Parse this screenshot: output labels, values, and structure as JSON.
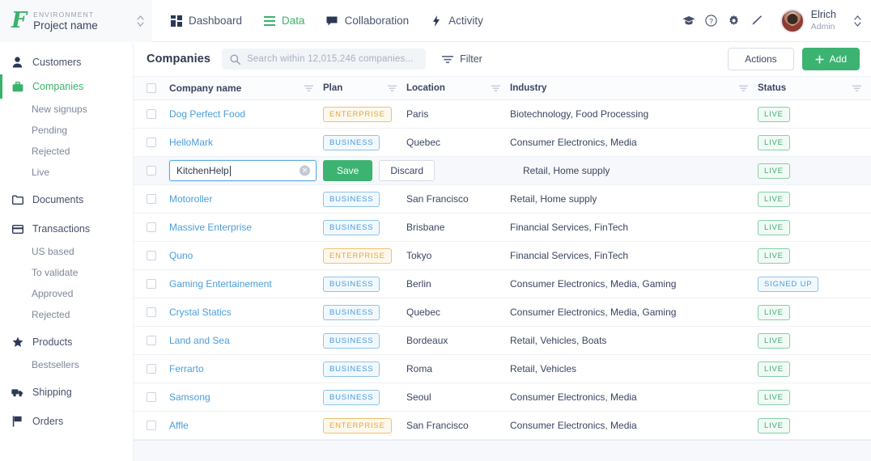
{
  "topbar": {
    "env_label": "ENVIRONMENT",
    "project_name": "Project name",
    "logo": "f-logo-icon",
    "tabs": [
      {
        "label": "Dashboard",
        "icon": "grid-icon",
        "active": false
      },
      {
        "label": "Data",
        "icon": "list-icon",
        "active": true
      },
      {
        "label": "Collaboration",
        "icon": "chat-icon",
        "active": false
      },
      {
        "label": "Activity",
        "icon": "bolt-icon",
        "active": false
      }
    ],
    "icons": [
      "graduation-cap-icon",
      "help-circle-icon",
      "gear-icon",
      "pen-icon"
    ],
    "user": {
      "name": "Elrich",
      "role": "Admin"
    }
  },
  "sidebar": {
    "items": [
      {
        "label": "Customers",
        "icon": "person-icon",
        "type": "main",
        "active": false
      },
      {
        "label": "Companies",
        "icon": "briefcase-icon",
        "type": "main",
        "active": true
      },
      {
        "label": "New signups",
        "type": "sub"
      },
      {
        "label": "Pending",
        "type": "sub"
      },
      {
        "label": "Rejected",
        "type": "sub"
      },
      {
        "label": "Live",
        "type": "sub"
      },
      {
        "label": "Documents",
        "icon": "folder-icon",
        "type": "main",
        "active": false
      },
      {
        "label": "Transactions",
        "icon": "card-icon",
        "type": "main",
        "active": false
      },
      {
        "label": "US based",
        "type": "sub"
      },
      {
        "label": "To validate",
        "type": "sub"
      },
      {
        "label": "Approved",
        "type": "sub"
      },
      {
        "label": "Rejected",
        "type": "sub"
      },
      {
        "label": "Products",
        "icon": "star-icon",
        "type": "main",
        "active": false
      },
      {
        "label": "Bestsellers",
        "type": "sub"
      },
      {
        "label": "Shipping",
        "icon": "truck-icon",
        "type": "main",
        "active": false
      },
      {
        "label": "Orders",
        "icon": "flag-icon",
        "type": "main",
        "active": false
      }
    ]
  },
  "content": {
    "title": "Companies",
    "search_placeholder": "Search within 12,015,246 companies...",
    "search_value": "",
    "filter_label": "Filter",
    "actions_label": "Actions",
    "add_label": "Add",
    "add_icon": "plus-icon"
  },
  "table": {
    "columns": [
      "Company name",
      "Plan",
      "Location",
      "Industry",
      "Status"
    ],
    "edit_row": {
      "input_value": "KitchenHelp",
      "save_label": "Save",
      "discard_label": "Discard",
      "clear_icon": "clear-circle-icon",
      "industry": "Retail, Home supply",
      "status": "LIVE"
    },
    "rows": [
      {
        "name": "Dog Perfect Food",
        "plan": "ENTERPRISE",
        "location": "Paris",
        "industry": "Biotechnology, Food Processing",
        "status": "LIVE",
        "editing": false
      },
      {
        "name": "HelloMark",
        "plan": "BUSINESS",
        "location": "Quebec",
        "industry": "Consumer Electronics, Media",
        "status": "LIVE",
        "editing": false
      },
      {
        "name": "KitchenHelp",
        "plan": "",
        "location": "",
        "industry": "Retail, Home supply",
        "status": "LIVE",
        "editing": true
      },
      {
        "name": "Motoroller",
        "plan": "BUSINESS",
        "location": "San Francisco",
        "industry": "Retail, Home supply",
        "status": "LIVE",
        "editing": false
      },
      {
        "name": "Massive Enterprise",
        "plan": "BUSINESS",
        "location": "Brisbane",
        "industry": "Financial Services, FinTech",
        "status": "LIVE",
        "editing": false
      },
      {
        "name": "Quno",
        "plan": "ENTERPRISE",
        "location": "Tokyo",
        "industry": "Financial Services, FinTech",
        "status": "LIVE",
        "editing": false
      },
      {
        "name": "Gaming Entertainement",
        "plan": "BUSINESS",
        "location": "Berlin",
        "industry": "Consumer Electronics, Media, Gaming",
        "status": "SIGNED UP",
        "editing": false
      },
      {
        "name": "Crystal Statics",
        "plan": "BUSINESS",
        "location": "Quebec",
        "industry": "Consumer Electronics, Media, Gaming",
        "status": "LIVE",
        "editing": false
      },
      {
        "name": "Land and Sea",
        "plan": "BUSINESS",
        "location": "Bordeaux",
        "industry": "Retail, Vehicles, Boats",
        "status": "LIVE",
        "editing": false
      },
      {
        "name": "Ferrarto",
        "plan": "BUSINESS",
        "location": "Roma",
        "industry": "Retail, Vehicles",
        "status": "LIVE",
        "editing": false
      },
      {
        "name": "Samsong",
        "plan": "BUSINESS",
        "location": "Seoul",
        "industry": "Consumer Electronics, Media",
        "status": "LIVE",
        "editing": false
      },
      {
        "name": "Affle",
        "plan": "ENTERPRISE",
        "location": "San Francisco",
        "industry": "Consumer Electronics, Media",
        "status": "LIVE",
        "editing": false
      }
    ]
  },
  "colors": {
    "brand_green": "#3cb371",
    "link_blue": "#4a9ddc",
    "enterprise_amber": "#e3a83c",
    "live_green": "#3fae74"
  }
}
